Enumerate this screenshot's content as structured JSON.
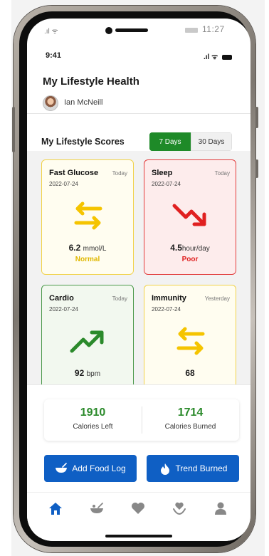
{
  "device_status": {
    "time": "11:27"
  },
  "app_status": {
    "time": "9:41"
  },
  "header": {
    "title": "My Lifestyle Health",
    "user_name": "Ian McNeill"
  },
  "scores": {
    "title": "My Lifestyle Scores",
    "range_options": [
      "7 Days",
      "30 Days"
    ],
    "selected_range": "7 Days",
    "cards": [
      {
        "name": "Fast Glucose",
        "when": "Today",
        "date": "2022-07-24",
        "value": "6.2",
        "unit": "mmol/L",
        "status": "Normal",
        "trend_icon": "stable-arrows-icon",
        "color": "#f1d24a",
        "status_color": "#e0b800"
      },
      {
        "name": "Sleep",
        "when": "Today",
        "date": "2022-07-24",
        "value": "4.5",
        "unit": "hour/day",
        "status": "Poor",
        "trend_icon": "trend-down-icon",
        "color": "#e23b3b",
        "status_color": "#e02020"
      },
      {
        "name": "Cardio",
        "when": "Today",
        "date": "2022-07-24",
        "value": "92",
        "unit": "bpm",
        "status": "",
        "trend_icon": "trend-up-icon",
        "color": "#4c9a4c",
        "status_color": "#2b8a2b"
      },
      {
        "name": "Immunity",
        "when": "Yesterday",
        "date": "2022-07-24",
        "value": "68",
        "unit": "",
        "status": "",
        "trend_icon": "stable-arrows-icon",
        "color": "#f1d24a",
        "status_color": "#e0b800"
      }
    ]
  },
  "calories": {
    "left_value": "1910",
    "left_label": "Calories Left",
    "burned_value": "1714",
    "burned_label": "Calories Burned"
  },
  "actions": {
    "add_food_log": "Add Food Log",
    "trend_burned": "Trend Burned"
  },
  "tabbar": {
    "items": [
      "home-icon",
      "food-icon",
      "heart-icon",
      "health-care-icon",
      "profile-icon"
    ],
    "active": "home-icon"
  },
  "colors": {
    "primary_blue": "#0f5fc4",
    "accent_green": "#1e8a28"
  }
}
